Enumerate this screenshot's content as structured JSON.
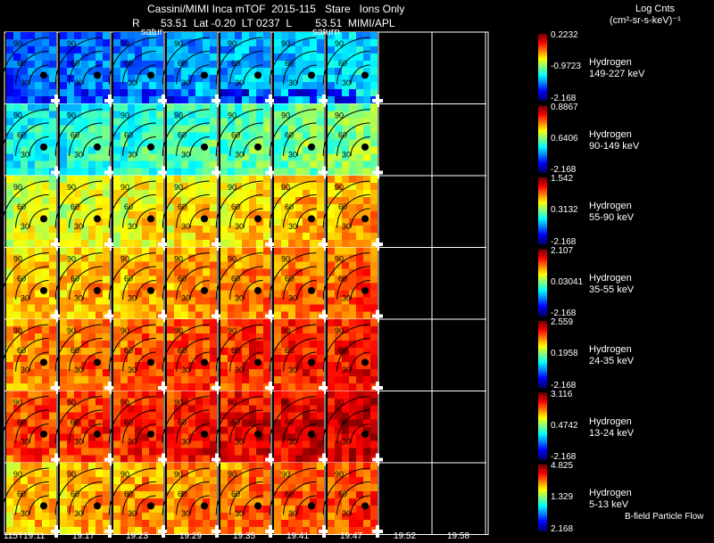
{
  "header": {
    "line1": "Cassini/MIMI Inca mTOF  2015-115   Stare   Ions Only",
    "line2_left": "R       53.51  Lat -0.20  LT 0237  L        53.51  MIMI/APL",
    "colorbar_title": "Log Cnts",
    "colorbar_units": "(cm²-sr-s-keV)⁻¹",
    "saturn_label_1": "satur",
    "saturn_label_2": "saturn",
    "footer_note": "B-field Particle Flow"
  },
  "chart_data": {
    "type": "heatmap",
    "columns": [
      "115T19:11",
      "19:17",
      "19:23",
      "19:29",
      "19:35",
      "19:41",
      "19:47",
      "19:52",
      "19:58"
    ],
    "filled_columns": 7,
    "rows": [
      {
        "species": "Hydrogen",
        "energy": "149-227 keV",
        "max": "0.2232",
        "mid": "-0.9723",
        "min": "-2.168",
        "level": 0.25
      },
      {
        "species": "Hydrogen",
        "energy": "90-149 keV",
        "max": "0.8867",
        "mid": "0.6406",
        "min": "-2.168",
        "level": 0.42
      },
      {
        "species": "Hydrogen",
        "energy": "55-90 keV",
        "max": "1.542",
        "mid": "0.3132",
        "min": "-2.168",
        "level": 0.62
      },
      {
        "species": "Hydrogen",
        "energy": "35-55 keV",
        "max": "2.107",
        "mid": "0.03041",
        "min": "-2.168",
        "level": 0.7
      },
      {
        "species": "Hydrogen",
        "energy": "24-35 keV",
        "max": "2.559",
        "mid": "0.1958",
        "min": "-2.168",
        "level": 0.78
      },
      {
        "species": "Hydrogen",
        "energy": "13-24 keV",
        "max": "3.116",
        "mid": "0.4742",
        "min": "-2.168",
        "level": 0.84
      },
      {
        "species": "Hydrogen",
        "energy": "5-13 keV",
        "max": "4.825",
        "mid": "1.329",
        "min": "2.168",
        "level": 0.72
      }
    ],
    "contour_labels": [
      "90",
      "60",
      "30"
    ]
  }
}
